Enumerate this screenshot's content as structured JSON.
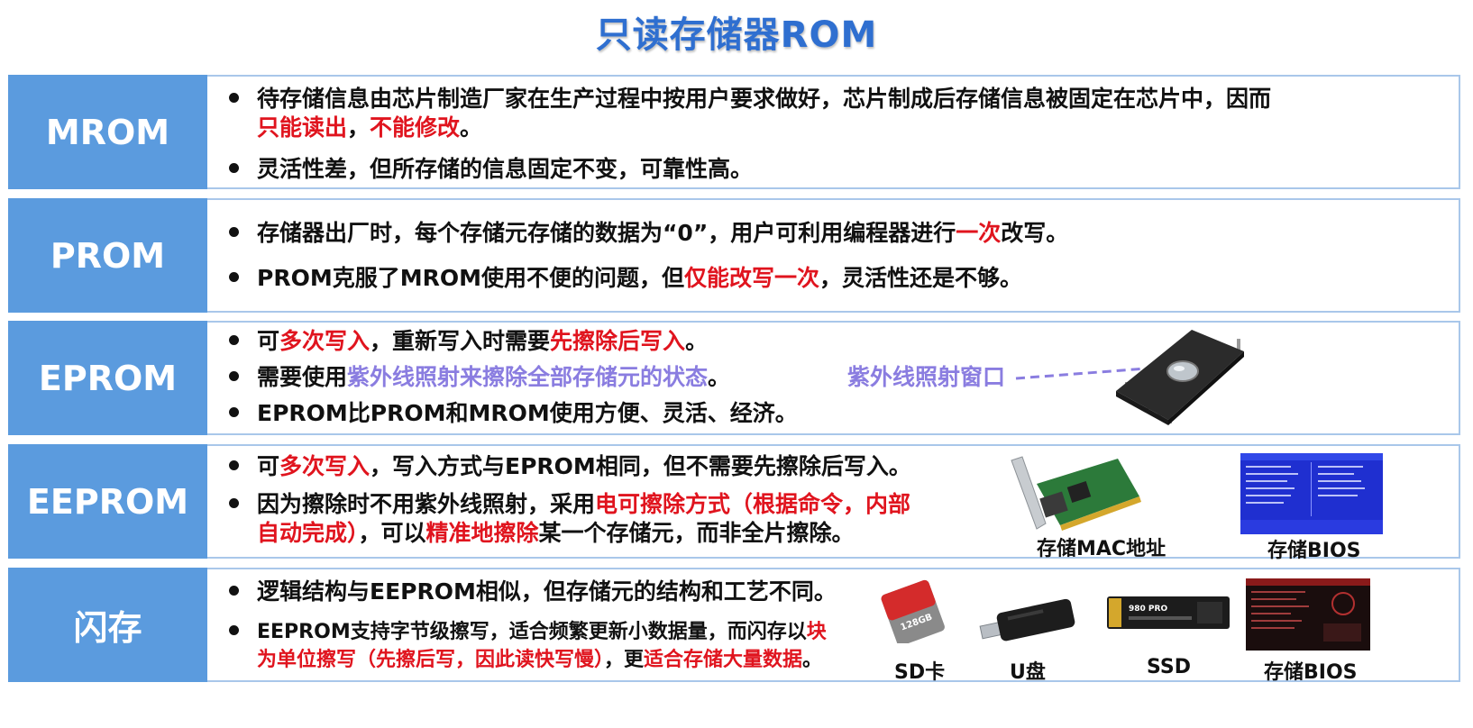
{
  "title": "只读存储器ROM",
  "rows": [
    {
      "label": "MROM",
      "line1a": "待存储信息由芯片制造厂家在生产过程中按用户要求做好，芯片制成后存储信息被固定在芯片中，因而",
      "line1b_red1": "只能读出",
      "line1b_sep": "，",
      "line1b_red2": "不能修改",
      "line1b_end": "。",
      "line2": "灵活性差，但所存储的信息固定不变，可靠性高。"
    },
    {
      "label": "PROM",
      "line1_pre": "存储器出厂时，每个存储元存储的数据为“0”，用户可利用编程器进行",
      "line1_red": "一次",
      "line1_post": "改写。",
      "line2_pre": "PROM克服了MROM使用不便的问题，但",
      "line2_red": "仅能改写一次",
      "line2_post": "，灵活性还是不够。"
    },
    {
      "label": "EPROM",
      "line1_pre": "可",
      "line1_red1": "多次写入",
      "line1_mid": "，重新写入时需要",
      "line1_red2": "先擦除后写入",
      "line1_post": "。",
      "line2_pre": "需要使用",
      "line2_purple": "紫外线照射来擦除全部存储元的状态",
      "line2_post": "。",
      "line3": "EPROM比PROM和MROM使用方便、灵活、经济。",
      "callout": "紫外线照射窗口"
    },
    {
      "label": "EEPROM",
      "line1_pre": "可",
      "line1_red": "多次写入",
      "line1_post": "，写入方式与EPROM相同，但不需要先擦除后写入。",
      "line2_pre": "因为擦除时不用紫外线照射，采用",
      "line2_red": "电可擦除方式（根据命令，内部",
      "line3_red1": "自动完成）",
      "line3_mid": "，可以",
      "line3_red2": "精准地擦除",
      "line3_post": "某一个存储元，而非全片擦除。",
      "cap1": "存储MAC地址",
      "cap2": "存储BIOS"
    },
    {
      "label": "闪存",
      "line1": "逻辑结构与EEPROM相似，但存储元的结构和工艺不同。",
      "line2_pre": "EEPROM支持字节级擦写，适合频繁更新小数据量，而闪存以",
      "line2_red": "块",
      "line3_red1": "为单位擦写（先擦后写，因此读快写慢）",
      "line3_mid": "，更",
      "line3_red2": "适合存储大量数据",
      "line3_post": "。",
      "cap1": "SD卡",
      "cap2": "U盘",
      "cap3": "SSD",
      "cap4": "存储BIOS",
      "sd_text": "128GB",
      "ssd_text": "980 PRO"
    }
  ],
  "colors": {
    "accent": "#5b9bde",
    "red": "#e0141e",
    "purple": "#8a7de0",
    "title": "#2f6fd0"
  }
}
